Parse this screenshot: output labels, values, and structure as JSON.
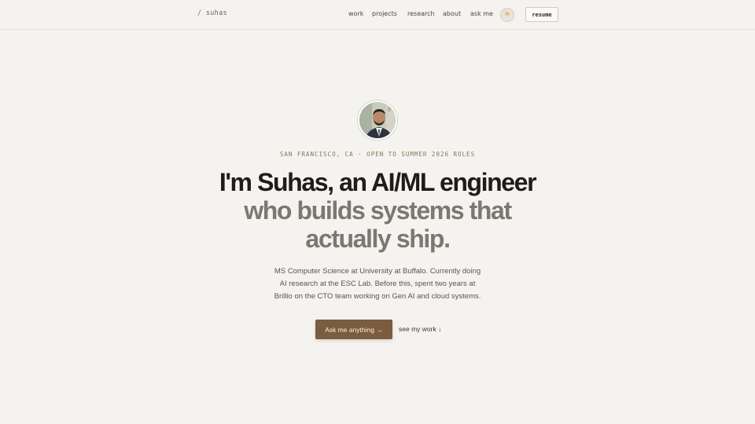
{
  "header": {
    "brand_prefix": "/",
    "brand_name": "suhas",
    "nav": [
      "work",
      "projects",
      "research",
      "about",
      "ask me"
    ],
    "theme_icon": "sun-icon",
    "resume_label": "resume"
  },
  "hero": {
    "location": "SAN FRANCISCO, CA · OPEN TO SUMMER 2026 ROLES",
    "headline_line1": "I'm Suhas, an AI/ML engineer",
    "headline_line2": "who builds systems that",
    "headline_line3": "actually ship.",
    "bio_line1": "MS Computer Science at University at Buffalo. Currently doing",
    "bio_line2": "AI research at the ESC Lab. Before this, spent two years at",
    "bio_line3": "Brillio on the CTO team working on Gen AI and cloud systems.",
    "cta_label": "Ask me anything →",
    "secondary_label": "see my work ↓"
  },
  "colors": {
    "background": "#f5f3ef",
    "accent": "#7a5c3e",
    "muted_text": "#7c7770"
  }
}
